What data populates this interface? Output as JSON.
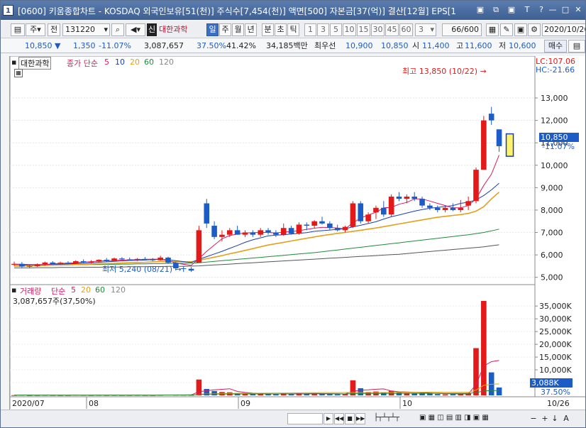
{
  "window": {
    "icon": "1",
    "title": "[0600] 키움종합차트 - KOSDAQ 외국인보유[51(천)] 주식수[7,454(천)] 액면[500] 자본금[37(억)] 결산[12월] EPS[1",
    "controls": [
      "▣",
      "⧉",
      "▣",
      "T",
      "?",
      "—",
      "□",
      "✕"
    ]
  },
  "toolbar1": {
    "type_label": "주",
    "prev_label": "전",
    "code": "131220",
    "stock_badge": "신",
    "stock_name": "대한과학",
    "periods": [
      "일",
      "주",
      "월",
      "년",
      "분",
      "초",
      "틱"
    ],
    "numbers": [
      "1",
      "3",
      "5",
      "10",
      "15",
      "30",
      "45",
      "60"
    ],
    "count_value": "3",
    "range": "66/600",
    "date": "2020/10/26"
  },
  "quote": {
    "price": "10,850",
    "change": "1,350",
    "change_pct": "-11.07%",
    "volume": "3,087,657",
    "ratio1": "37.50%",
    "ratio2": "41.42%",
    "amount": "34,185백만",
    "best_label": "최우선",
    "best1": "10,900",
    "best2": "10,850",
    "open_label": "시",
    "open": "11,400",
    "high_label": "고",
    "high": "11,600",
    "low_label": "저",
    "low": "10,600",
    "buy_label": "매수"
  },
  "price_panel": {
    "stock_label": "대한과학",
    "ma_title": "종가 단순",
    "ma_periods": [
      "5",
      "10",
      "20",
      "60",
      "120"
    ],
    "ma_colors": [
      "#d81b60",
      "#1a3fb3",
      "#e3a11a",
      "#1f8a3a",
      "#555555"
    ],
    "lc": "LC:107.06",
    "hc": "HC:-21.66",
    "high_annot": "최고 13,850 (10/22)",
    "low_annot": "최저 5,240 (08/21)",
    "current_price": "10,850",
    "current_pct": "-11.07%",
    "y_labels": [
      "13,000",
      "12,000",
      "11,000",
      "10,000",
      "9,000",
      "8,000",
      "7,000",
      "6,000",
      "5,000"
    ],
    "y_values": [
      13000,
      12000,
      11000,
      10000,
      9000,
      8000,
      7000,
      6000,
      5000
    ]
  },
  "volume_panel": {
    "title": "거래량",
    "ma_title": "단순",
    "ma_periods": [
      "5",
      "20",
      "60",
      "120"
    ],
    "ma_colors": [
      "#d81b60",
      "#e3a11a",
      "#1f8a3a",
      "#555555"
    ],
    "value": "3,087,657주(37,50%)",
    "y_labels": [
      "35,000K",
      "30,000K",
      "25,000K",
      "20,000K",
      "15,000K",
      "10,000K",
      "5,000K"
    ],
    "y_values": [
      35000,
      30000,
      25000,
      20000,
      15000,
      10000,
      5000
    ],
    "current": "3,088K",
    "current_pct": "37.50%"
  },
  "x_axis": {
    "labels": [
      "2020/07",
      "08",
      "09",
      "10",
      "10/26"
    ]
  },
  "colors": {
    "up": "#e31a1a",
    "down": "#1c5cc7",
    "title": "#3e5f93"
  },
  "chart_data": {
    "type": "candlestick",
    "title": "",
    "ylim": [
      4800,
      14300
    ],
    "candles": [
      [
        5560,
        5700,
        5500,
        5600,
        80
      ],
      [
        5600,
        5680,
        5440,
        5480,
        160
      ],
      [
        5480,
        5560,
        5420,
        5500,
        60
      ],
      [
        5500,
        5620,
        5460,
        5580,
        70
      ],
      [
        5580,
        5700,
        5520,
        5660,
        120
      ],
      [
        5660,
        5720,
        5560,
        5600,
        90
      ],
      [
        5600,
        5700,
        5560,
        5650,
        60
      ],
      [
        5650,
        5720,
        5580,
        5620,
        70
      ],
      [
        5620,
        5760,
        5600,
        5720,
        150
      ],
      [
        5720,
        5800,
        5640,
        5680,
        110
      ],
      [
        5680,
        5760,
        5620,
        5700,
        80
      ],
      [
        5700,
        5800,
        5650,
        5780,
        120
      ],
      [
        5780,
        5860,
        5700,
        5720,
        90
      ],
      [
        5720,
        5880,
        5700,
        5840,
        110
      ],
      [
        5840,
        5900,
        5760,
        5800,
        80
      ],
      [
        5800,
        5880,
        5740,
        5780,
        90
      ],
      [
        5780,
        5860,
        5720,
        5820,
        120
      ],
      [
        5820,
        5900,
        5760,
        5790,
        90
      ],
      [
        5790,
        5860,
        5720,
        5760,
        80
      ],
      [
        5760,
        5960,
        5740,
        5880,
        150
      ],
      [
        5880,
        5920,
        5600,
        5650,
        260
      ],
      [
        5650,
        5700,
        5300,
        5400,
        200
      ],
      [
        5400,
        5500,
        5240,
        5380,
        180
      ],
      [
        5380,
        5460,
        5240,
        5300,
        150
      ],
      [
        5650,
        7300,
        5650,
        7100,
        6200
      ],
      [
        8300,
        8500,
        7200,
        7400,
        2500
      ],
      [
        7300,
        7500,
        6700,
        6800,
        1700
      ],
      [
        6800,
        7100,
        6600,
        6900,
        1300
      ],
      [
        6900,
        7200,
        6800,
        7100,
        1200
      ],
      [
        7100,
        7300,
        6900,
        6900,
        900
      ],
      [
        6900,
        7100,
        6800,
        7000,
        600
      ],
      [
        7000,
        7100,
        6800,
        6900,
        500
      ],
      [
        6900,
        7200,
        6800,
        7100,
        700
      ],
      [
        7100,
        7200,
        6900,
        7000,
        500
      ],
      [
        7000,
        7100,
        6800,
        6900,
        400
      ],
      [
        6900,
        7400,
        6850,
        7200,
        900
      ],
      [
        7200,
        7300,
        6900,
        6950,
        600
      ],
      [
        6950,
        7450,
        6900,
        7350,
        800
      ],
      [
        7350,
        7450,
        7100,
        7300,
        700
      ],
      [
        7300,
        7550,
        7200,
        7500,
        800
      ],
      [
        7500,
        7700,
        7350,
        7400,
        600
      ],
      [
        7400,
        7500,
        7100,
        7200,
        500
      ],
      [
        7200,
        7350,
        7050,
        7100,
        400
      ],
      [
        7100,
        7300,
        7000,
        7250,
        500
      ],
      [
        7250,
        8400,
        7200,
        8300,
        5900
      ],
      [
        8300,
        8400,
        7400,
        7500,
        2800
      ],
      [
        7500,
        7900,
        7400,
        7800,
        1300
      ],
      [
        7900,
        8200,
        7600,
        8100,
        1500
      ],
      [
        8100,
        8400,
        7700,
        7800,
        1200
      ],
      [
        7800,
        8700,
        7700,
        8600,
        1800
      ],
      [
        8600,
        8800,
        8400,
        8500,
        1100
      ],
      [
        8500,
        8700,
        8300,
        8600,
        900
      ],
      [
        8600,
        8800,
        8400,
        8500,
        800
      ],
      [
        8500,
        8600,
        8100,
        8200,
        1000
      ],
      [
        8200,
        8300,
        8000,
        8100,
        700
      ],
      [
        8100,
        8200,
        7900,
        8000,
        500
      ],
      [
        8000,
        8200,
        7900,
        8100,
        400
      ],
      [
        8100,
        8300,
        7950,
        8000,
        500
      ],
      [
        8000,
        8450,
        7900,
        8100,
        600
      ],
      [
        8200,
        8600,
        8000,
        8400,
        900
      ],
      [
        8400,
        9900,
        8300,
        9800,
        18500
      ],
      [
        9800,
        12200,
        9800,
        12000,
        37000
      ],
      [
        12300,
        12600,
        11800,
        12000,
        9000
      ],
      [
        11600,
        11600,
        10600,
        10850,
        3088
      ]
    ],
    "ma5": [
      5580,
      5560,
      5550,
      5560,
      5570,
      5600,
      5620,
      5630,
      5650,
      5680,
      5700,
      5720,
      5740,
      5750,
      5770,
      5780,
      5790,
      5800,
      5810,
      5810,
      5740,
      5640,
      5580,
      5530,
      5840,
      6160,
      6440,
      6720,
      6860,
      6930,
      6980,
      6990,
      7000,
      7000,
      6980,
      7020,
      7040,
      7080,
      7140,
      7190,
      7230,
      7220,
      7200,
      7160,
      7430,
      7640,
      7780,
      7900,
      8100,
      8120,
      8260,
      8340,
      8500,
      8500,
      8400,
      8300,
      8200,
      8100,
      8100,
      8200,
      8500,
      9100,
      9600,
      10450
    ],
    "ma10": [
      5590,
      5580,
      5570,
      5570,
      5570,
      5580,
      5590,
      5600,
      5610,
      5630,
      5650,
      5670,
      5690,
      5710,
      5730,
      5750,
      5760,
      5770,
      5790,
      5800,
      5780,
      5740,
      5700,
      5660,
      5800,
      5920,
      6040,
      6160,
      6290,
      6420,
      6560,
      6670,
      6760,
      6850,
      6880,
      6900,
      6930,
      6960,
      6990,
      7050,
      7080,
      7110,
      7140,
      7170,
      7250,
      7320,
      7400,
      7480,
      7600,
      7700,
      7780,
      7870,
      7950,
      8020,
      8080,
      8120,
      8160,
      8200,
      8300,
      8350,
      8450,
      8650,
      8900,
      9200
    ],
    "ma20": [
      5500,
      5500,
      5510,
      5520,
      5530,
      5540,
      5550,
      5560,
      5570,
      5580,
      5590,
      5600,
      5610,
      5620,
      5640,
      5650,
      5660,
      5670,
      5690,
      5700,
      5700,
      5700,
      5690,
      5690,
      5760,
      5830,
      5900,
      5970,
      6050,
      6120,
      6200,
      6280,
      6360,
      6440,
      6500,
      6560,
      6620,
      6680,
      6740,
      6800,
      6860,
      6910,
      6960,
      7000,
      7050,
      7100,
      7150,
      7200,
      7260,
      7320,
      7380,
      7440,
      7500,
      7560,
      7620,
      7680,
      7720,
      7760,
      7800,
      7850,
      7950,
      8150,
      8500,
      8800
    ],
    "ma60": [
      5520,
      5520,
      5530,
      5530,
      5540,
      5540,
      5550,
      5550,
      5560,
      5560,
      5570,
      5570,
      5580,
      5580,
      5590,
      5590,
      5600,
      5600,
      5610,
      5610,
      5620,
      5620,
      5620,
      5630,
      5650,
      5680,
      5710,
      5740,
      5770,
      5800,
      5830,
      5860,
      5890,
      5920,
      5950,
      5980,
      6010,
      6040,
      6070,
      6100,
      6140,
      6180,
      6220,
      6260,
      6300,
      6340,
      6380,
      6420,
      6460,
      6500,
      6540,
      6580,
      6620,
      6660,
      6700,
      6740,
      6780,
      6820,
      6860,
      6900,
      6950,
      7000,
      7070,
      7150
    ],
    "ma120": [
      5420,
      5420,
      5420,
      5430,
      5430,
      5430,
      5440,
      5440,
      5440,
      5450,
      5450,
      5450,
      5460,
      5460,
      5460,
      5470,
      5470,
      5470,
      5480,
      5480,
      5490,
      5490,
      5490,
      5500,
      5510,
      5530,
      5550,
      5570,
      5590,
      5610,
      5630,
      5650,
      5670,
      5690,
      5710,
      5730,
      5750,
      5770,
      5790,
      5810,
      5830,
      5850,
      5870,
      5890,
      5910,
      5930,
      5950,
      5970,
      5990,
      6010,
      6030,
      6060,
      6090,
      6120,
      6150,
      6180,
      6210,
      6240,
      6270,
      6300,
      6330,
      6360,
      6410,
      6450
    ],
    "vol_ylim": [
      0,
      39500
    ],
    "x_labels": [
      "2020/07",
      "08",
      "09",
      "10",
      "10/26"
    ]
  }
}
